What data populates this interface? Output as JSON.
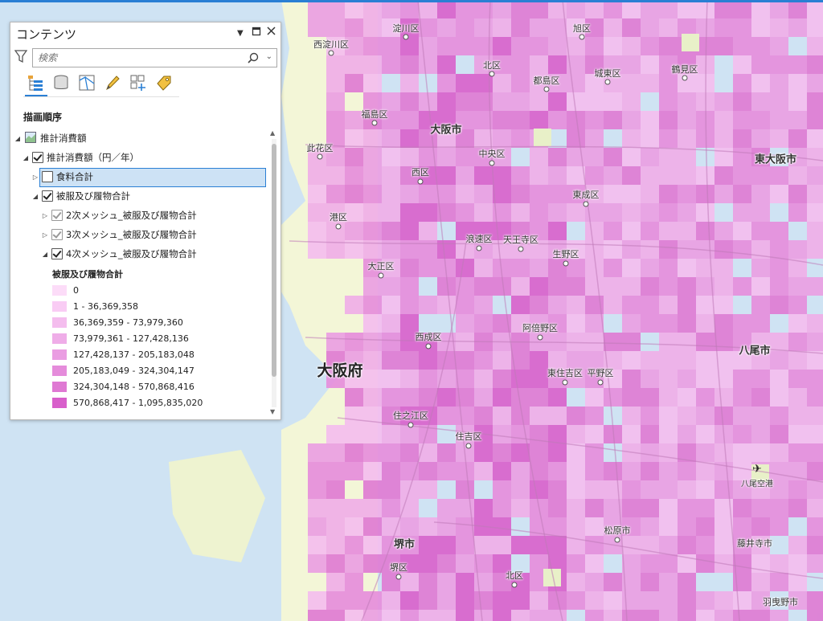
{
  "pane": {
    "title": "コンテンツ",
    "search_placeholder": "検索",
    "heading": "描画順序",
    "tree": [
      {
        "label": "推計消費額"
      },
      {
        "label": "推計消費額（円／年）"
      },
      {
        "label": "食料合計"
      },
      {
        "label": "被服及び履物合計"
      },
      {
        "label": "2次メッシュ_被服及び履物合計"
      },
      {
        "label": "3次メッシュ_被服及び履物合計"
      },
      {
        "label": "4次メッシュ_被服及び履物合計"
      }
    ],
    "legend": {
      "title": "被服及び履物合計",
      "classes": [
        {
          "label": "0",
          "color": "#fcdcf8"
        },
        {
          "label": "1 - 36,369,358",
          "color": "#f9ccf4"
        },
        {
          "label": "36,369,359 - 73,979,360",
          "color": "#f4bdee"
        },
        {
          "label": "73,979,361 - 127,428,136",
          "color": "#efade8"
        },
        {
          "label": "127,428,137 - 205,183,048",
          "color": "#ea9de2"
        },
        {
          "label": "205,183,049 - 324,304,147",
          "color": "#e58cdb"
        },
        {
          "label": "324,304,148 - 570,868,416",
          "color": "#df79d3"
        },
        {
          "label": "570,868,417 - 1,095,835,020",
          "color": "#d85fcb"
        }
      ]
    }
  },
  "map": {
    "labels": [
      {
        "text": "淀川区"
      },
      {
        "text": "旭区"
      },
      {
        "text": "西淀川区"
      },
      {
        "text": "北区"
      },
      {
        "text": "都島区"
      },
      {
        "text": "城東区"
      },
      {
        "text": "鶴見区"
      },
      {
        "text": "福島区"
      },
      {
        "text": "大阪市"
      },
      {
        "text": "此花区"
      },
      {
        "text": "中央区"
      },
      {
        "text": "東大阪市"
      },
      {
        "text": "西区"
      },
      {
        "text": "東成区"
      },
      {
        "text": "港区"
      },
      {
        "text": "浪速区"
      },
      {
        "text": "天王寺区"
      },
      {
        "text": "生野区"
      },
      {
        "text": "大正区"
      },
      {
        "text": "阿倍野区"
      },
      {
        "text": "西成区"
      },
      {
        "text": "八尾市"
      },
      {
        "text": "大阪府"
      },
      {
        "text": "東住吉区"
      },
      {
        "text": "平野区"
      },
      {
        "text": "住之江区"
      },
      {
        "text": "住吉区"
      },
      {
        "text": "八尾空港"
      },
      {
        "text": "松原市"
      },
      {
        "text": "堺市"
      },
      {
        "text": "藤井寺市"
      },
      {
        "text": "堺区"
      },
      {
        "text": "北区"
      },
      {
        "text": "羽曳野市"
      }
    ]
  }
}
